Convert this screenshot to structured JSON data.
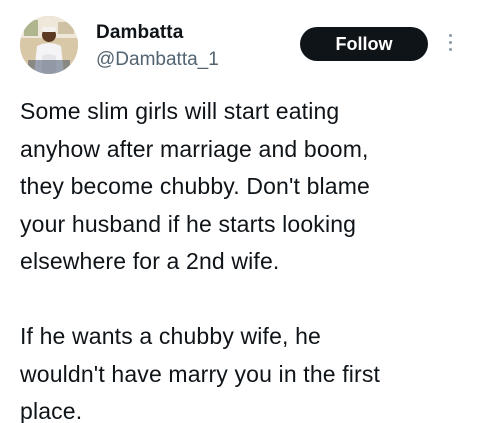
{
  "author": {
    "name": "Dambatta",
    "handle": "@Dambatta_1"
  },
  "actions": {
    "follow_label": "Follow",
    "more_icon": "more-vertical-icon"
  },
  "tweet": {
    "paragraph_1": "Some slim girls will start eating\nanyhow after marriage and boom,\nthey become chubby. Don't blame\nyour husband if he starts looking\nelsewhere for a 2nd wife.",
    "paragraph_2": "If he wants a chubby wife, he\nwouldn't have marry you in the first\nplace."
  },
  "colors": {
    "text": "#0f1419",
    "secondary": "#536471",
    "follow_bg": "#0f1419",
    "follow_text": "#ffffff"
  }
}
